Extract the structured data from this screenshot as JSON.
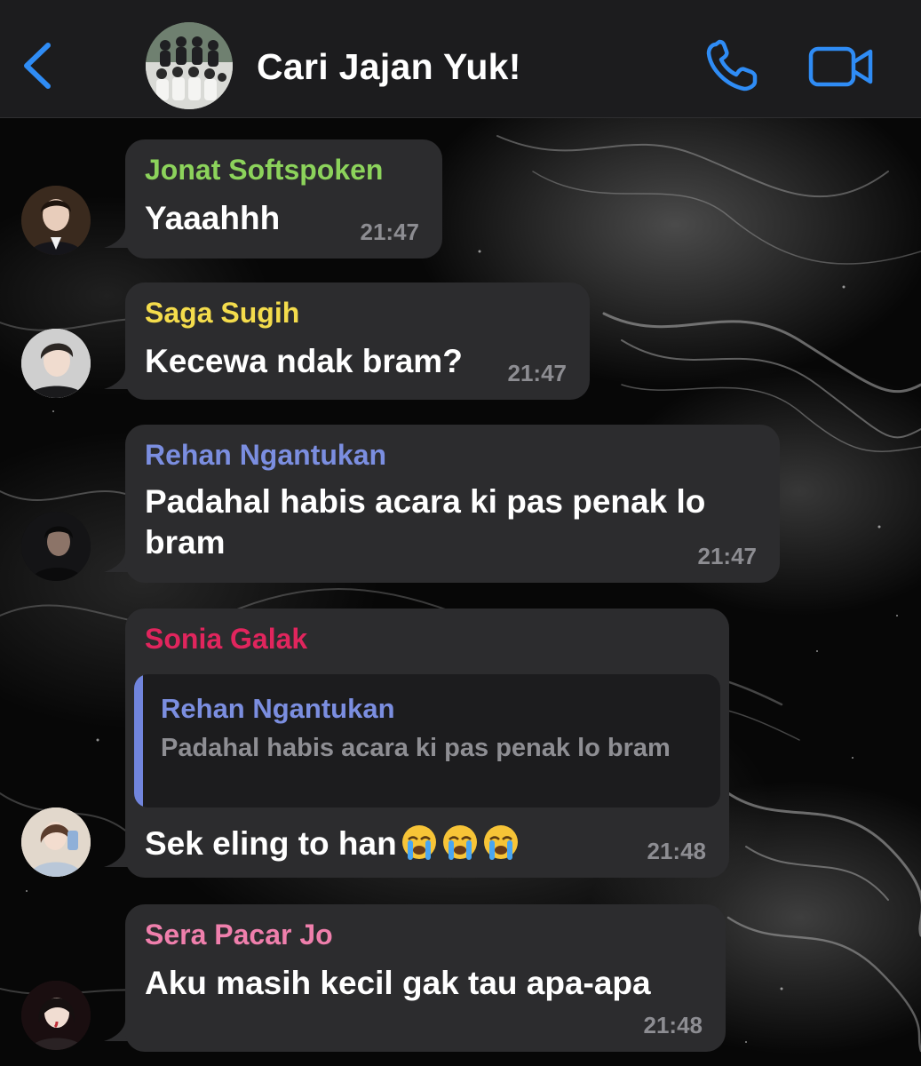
{
  "header": {
    "title": "Cari Jajan Yuk!",
    "accent_color": "#2f8cf5"
  },
  "messages": [
    {
      "sender": "Jonat Softspoken",
      "sender_color": "#8cd35b",
      "text": "Yaaahhh",
      "time": "21:47"
    },
    {
      "sender": "Saga Sugih",
      "sender_color": "#f4dc4c",
      "text": "Kecewa ndak bram?",
      "time": "21:47"
    },
    {
      "sender": "Rehan Ngantukan",
      "sender_color": "#7b8ee0",
      "text_line1": "Padahal habis acara ki pas penak lo",
      "text_line2": "bram",
      "time": "21:47"
    },
    {
      "sender": "Sonia Galak",
      "sender_color": "#e1255d",
      "quote": {
        "sender": "Rehan Ngantukan",
        "text": "Padahal habis acara ki pas penak lo bram"
      },
      "text": "Sek eling to han",
      "emojis": [
        "loudly-crying-face",
        "loudly-crying-face",
        "loudly-crying-face"
      ],
      "time": "21:48"
    },
    {
      "sender": "Sera Pacar Jo",
      "sender_color": "#ef7fac",
      "text": "Aku masih kecil gak tau apa-apa",
      "time": "21:48"
    }
  ],
  "icons": {
    "back": "chevron-left-icon",
    "call": "phone-icon",
    "video": "video-camera-icon"
  }
}
